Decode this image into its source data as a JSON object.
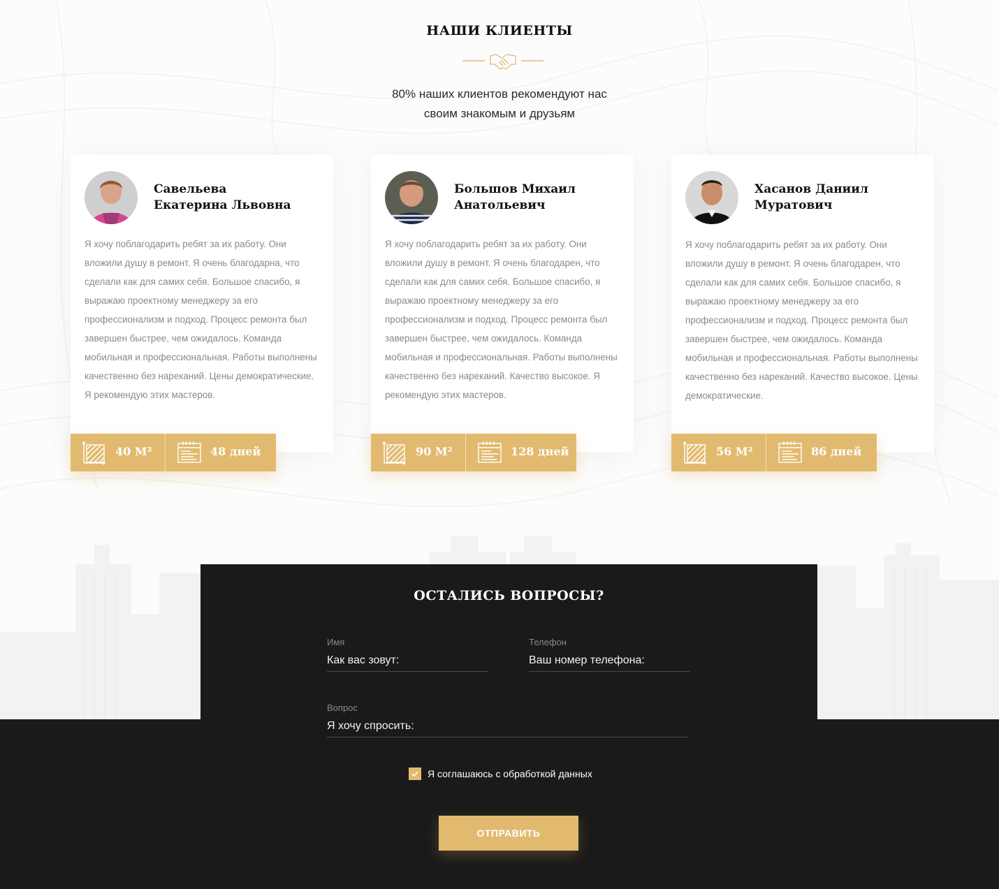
{
  "section": {
    "title": "НАШИ КЛИЕНТЫ",
    "divider_icon": "handshake-icon",
    "subtitle_line1": "80% наших клиентов рекомендуют нас",
    "subtitle_line2": "своим знакомым и друзьям"
  },
  "reviews": [
    {
      "name_line1": "Савельева",
      "name_line2": "Екатерина Львовна",
      "text": "Я хочу поблагодарить ребят за их работу. Они вложили душу в ремонт. Я очень благодарна, что сделали как для самих себя. Большое спасибо, я выражаю проектному менеджеру за его профессионализм и подход. Процесс ремонта был завершен быстрее, чем ожидалось. Команда мобильная и профессиональная. Работы выполнены качественно без нареканий. Цены демократические. Я рекомендую этих мастеров.",
      "area": "40 М²",
      "duration": "48 дней"
    },
    {
      "name_line1": "Большов Михаил",
      "name_line2": "Анатольевич",
      "text": "Я хочу поблагодарить ребят за их работу. Они вложили душу в ремонт. Я очень благодарен, что сделали как для самих себя. Большое спасибо, я выражаю проектному менеджеру за его профессионализм и подход. Процесс ремонта был завершен быстрее, чем ожидалось. Команда мобильная и профессиональная. Работы выполнены качественно без нареканий. Качество высокое. Я рекомендую этих мастеров.",
      "area": "90 М²",
      "duration": "128 дней"
    },
    {
      "name_line1": "Хасанов Даниил",
      "name_line2": "Муратович",
      "text": "Я хочу поблагодарить ребят за их работу. Они вложили душу в ремонт. Я очень благодарен, что сделали как для самих себя. Большое спасибо, я выражаю проектному менеджеру за его профессионализм и подход. Процесс ремонта был завершен быстрее, чем ожидалось. Команда мобильная и профессиональная. Работы выполнены качественно без нареканий. Качество высокое. Цены демократические.",
      "area": "56 М²",
      "duration": "86 дней"
    }
  ],
  "form": {
    "title": "ОСТАЛИСЬ ВОПРОСЫ?",
    "name_label": "Имя",
    "name_placeholder": "Как вас зовут:",
    "phone_label": "Телефон",
    "phone_placeholder": "Ваш номер телефона:",
    "question_label": "Вопрос",
    "question_placeholder": "Я хочу спросить:",
    "consent_checked": true,
    "consent_text": "Я соглашаюсь с обработкой данных",
    "submit_label": "ОТПРАВИТЬ"
  },
  "colors": {
    "accent": "#e2ba6f",
    "dark": "#1a1a1a",
    "text_muted": "#8a8a8a"
  }
}
